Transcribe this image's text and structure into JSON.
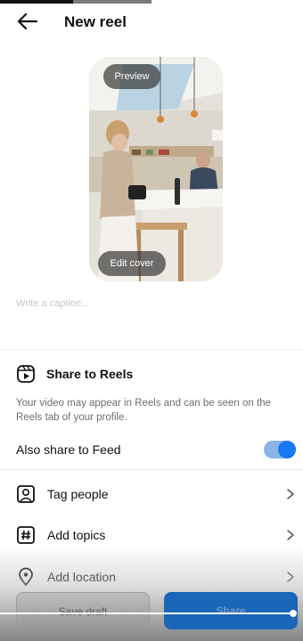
{
  "header": {
    "title": "New reel",
    "back_icon": "arrow-left-icon"
  },
  "preview": {
    "preview_label": "Preview",
    "edit_cover_label": "Edit cover"
  },
  "caption": {
    "placeholder": "Write a caption..."
  },
  "reels": {
    "title": "Share to Reels",
    "icon": "reels-icon",
    "description": "Your video may appear in Reels and can be seen on the Reels tab of your profile."
  },
  "feed": {
    "label": "Also share to Feed",
    "enabled": true
  },
  "options": [
    {
      "label": "Tag people",
      "icon": "tag-person-icon"
    },
    {
      "label": "Add topics",
      "icon": "hashtag-icon"
    },
    {
      "label": "Add location",
      "icon": "location-pin-icon"
    }
  ],
  "actions": {
    "save_draft_label": "Save draft",
    "share_label": "Share"
  },
  "colors": {
    "accent": "#1877f2",
    "share_button": "#1a66b8"
  }
}
